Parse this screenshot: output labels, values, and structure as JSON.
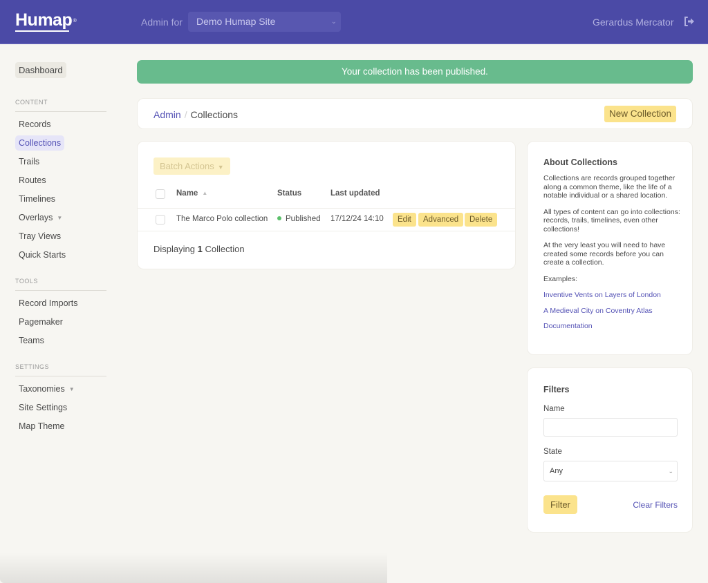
{
  "header": {
    "logo": "Humap",
    "logo_mark": "®",
    "admin_for_label": "Admin for",
    "site_select_value": "Demo Humap Site",
    "user_name": "Gerardus Mercator",
    "logout_icon": "logout-icon"
  },
  "sidebar": {
    "dashboard_label": "Dashboard",
    "sections": [
      {
        "title": "CONTENT",
        "items": [
          {
            "label": "Records"
          },
          {
            "label": "Collections",
            "active": true
          },
          {
            "label": "Trails"
          },
          {
            "label": "Routes"
          },
          {
            "label": "Timelines"
          },
          {
            "label": "Overlays",
            "has_dropdown": true
          },
          {
            "label": "Tray Views"
          },
          {
            "label": "Quick Starts"
          }
        ]
      },
      {
        "title": "TOOLS",
        "items": [
          {
            "label": "Record Imports"
          },
          {
            "label": "Pagemaker"
          },
          {
            "label": "Teams"
          }
        ]
      },
      {
        "title": "SETTINGS",
        "items": [
          {
            "label": "Taxonomies",
            "has_dropdown": true
          },
          {
            "label": "Site Settings"
          },
          {
            "label": "Map Theme"
          }
        ]
      }
    ]
  },
  "alert": {
    "message": "Your collection has been published.",
    "color": "#68bb8d"
  },
  "breadcrumb": {
    "root": "Admin",
    "separator": "/",
    "current": "Collections",
    "new_button": "New Collection"
  },
  "table": {
    "batch_actions_label": "Batch Actions",
    "columns": [
      "Name",
      "Status",
      "Last updated"
    ],
    "rows": [
      {
        "name": "The Marco Polo collection",
        "status": "Published",
        "status_color": "#5bc06a",
        "last_updated": "17/12/24 14:10",
        "actions": [
          "Edit",
          "Advanced",
          "Delete"
        ]
      }
    ],
    "footer_prefix": "Displaying",
    "footer_count": "1",
    "footer_suffix": "Collection"
  },
  "about": {
    "title": "About Collections",
    "paragraphs": [
      "Collections are records grouped together along a common theme, like the life of a notable individual or a shared location.",
      "All types of content can go into collections: records, trails, timelines, even other collections!",
      "At the very least you will need to have created some records before you can create a collection.",
      "Examples:"
    ],
    "links": [
      "Inventive Vents on Layers of London",
      "A Medieval City on Coventry Atlas",
      "Documentation"
    ]
  },
  "filters": {
    "title": "Filters",
    "name_label": "Name",
    "name_value": "",
    "name_placeholder": "",
    "state_label": "State",
    "state_value": "Any",
    "filter_button": "Filter",
    "clear_link": "Clear Filters"
  },
  "colors": {
    "brand": "#4b4aa6",
    "accent_link": "#5452b5",
    "button_yellow": "#fbe38c"
  }
}
